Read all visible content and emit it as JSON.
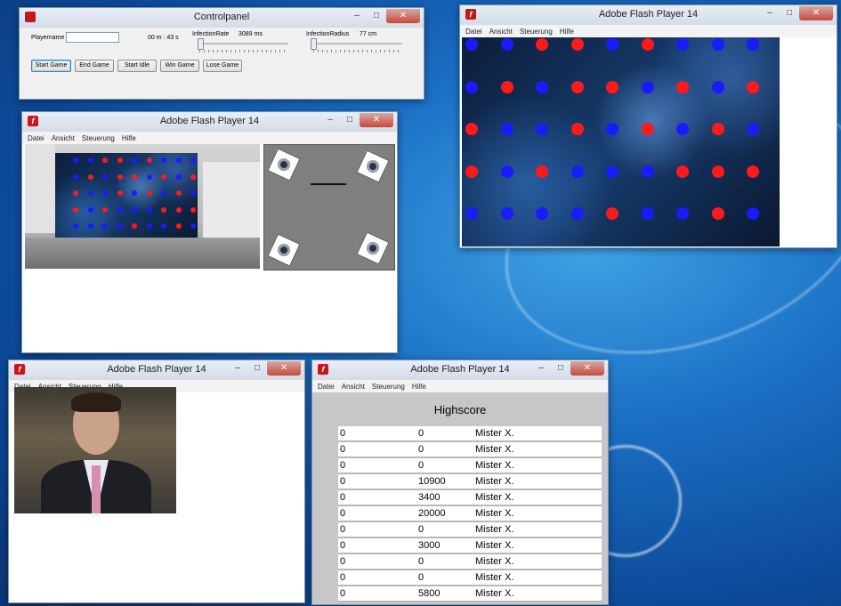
{
  "control_panel": {
    "title": "Controlpanel",
    "playername_label": "Playername",
    "timer": "00 m : 43 s",
    "infection_rate_label": "InfectionRate",
    "infection_rate_value": "3089 ms",
    "infection_radius_label": "InfectionRadius",
    "infection_radius_value": "77 cm",
    "buttons": [
      "Start Game",
      "End Game",
      "Start Idle",
      "Win Game",
      "Lose Game"
    ]
  },
  "flash": {
    "title": "Adobe Flash Player 14",
    "menu": [
      "Datei",
      "Ansicht",
      "Steuerung",
      "Hilfe"
    ]
  },
  "window_controls": {
    "minimize": "–",
    "maximize": "□",
    "close": "✕"
  },
  "grid_colors": {
    "red": "#ff1a1a",
    "blue": "#1a1aff"
  },
  "neuron_grid": [
    [
      "b",
      "b",
      "r",
      "r",
      "b",
      "r",
      "b",
      "b",
      "b"
    ],
    [
      "b",
      "r",
      "b",
      "r",
      "r",
      "b",
      "r",
      "b",
      "r"
    ],
    [
      "r",
      "b",
      "b",
      "r",
      "b",
      "r",
      "b",
      "r",
      "b"
    ],
    [
      "r",
      "b",
      "r",
      "b",
      "b",
      "b",
      "r",
      "r",
      "r"
    ],
    [
      "b",
      "b",
      "b",
      "b",
      "r",
      "b",
      "b",
      "r",
      "b"
    ]
  ],
  "highscore": {
    "title": "Highscore",
    "rows": [
      [
        "0",
        "0",
        "Mister X."
      ],
      [
        "0",
        "0",
        "Mister X."
      ],
      [
        "0",
        "0",
        "Mister X."
      ],
      [
        "0",
        "10900",
        "Mister X."
      ],
      [
        "0",
        "3400",
        "Mister X."
      ],
      [
        "0",
        "20000",
        "Mister X."
      ],
      [
        "0",
        "0",
        "Mister X."
      ],
      [
        "0",
        "3000",
        "Mister X."
      ],
      [
        "0",
        "0",
        "Mister X."
      ],
      [
        "0",
        "0",
        "Mister X."
      ],
      [
        "0",
        "5800",
        "Mister X."
      ]
    ]
  }
}
